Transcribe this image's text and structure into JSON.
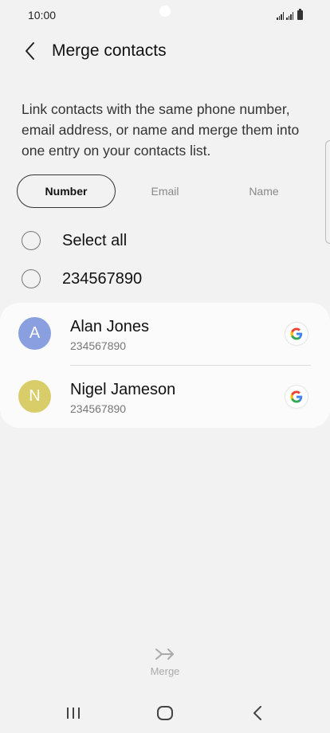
{
  "status_bar": {
    "time": "10:00"
  },
  "header": {
    "title": "Merge contacts",
    "back_icon": "chevron-left-icon"
  },
  "description": "Link contacts with the same phone number, email address, or name and merge them into one entry on your contacts list.",
  "tabs": [
    {
      "label": "Number",
      "active": true
    },
    {
      "label": "Email",
      "active": false
    },
    {
      "label": "Name",
      "active": false
    }
  ],
  "select_all": {
    "label": "Select all",
    "checked": false
  },
  "group": {
    "label": "234567890",
    "checked": false
  },
  "contacts": [
    {
      "initial": "A",
      "name": "Alan Jones",
      "phone": "234567890",
      "avatar_color": "#8a9fe0",
      "account_icon": "google-icon"
    },
    {
      "initial": "N",
      "name": "Nigel Jameson",
      "phone": "234567890",
      "avatar_color": "#d9cd6a",
      "account_icon": "google-icon"
    }
  ],
  "merge": {
    "label": "Merge",
    "icon": "merge-arrow-icon",
    "enabled": false
  },
  "colors": {
    "background": "#f2f2f2",
    "card": "#fbfbfb",
    "disabled": "#aaaaaa"
  }
}
